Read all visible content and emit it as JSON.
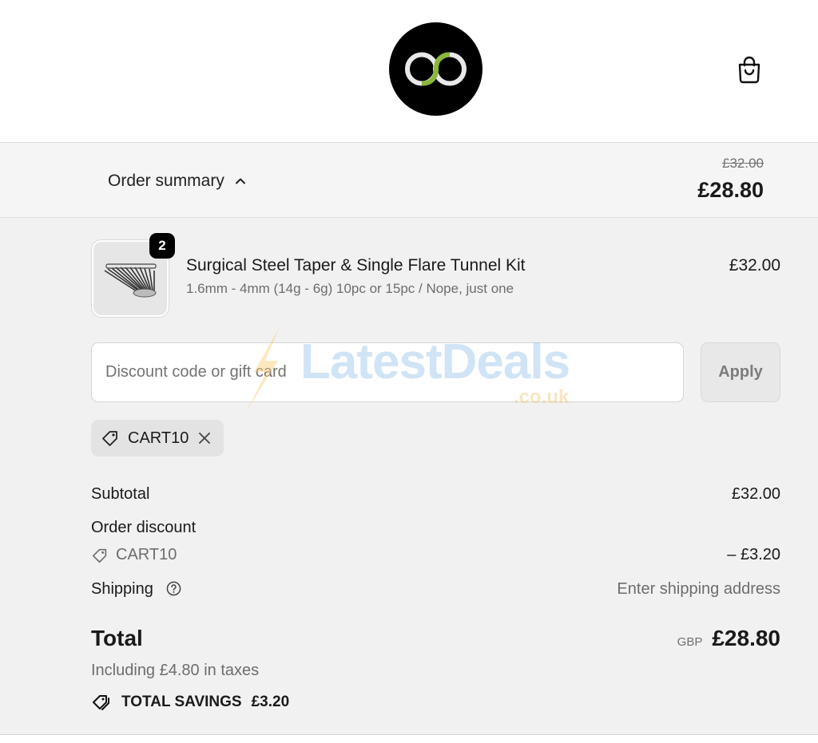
{
  "header": {
    "logo": "store-logo",
    "cart_icon": "shopping-bag-icon"
  },
  "summary_bar": {
    "label": "Order summary",
    "original_price": "£32.00",
    "discounted_price": "£28.80"
  },
  "line_items": [
    {
      "quantity": "2",
      "name": "Surgical Steel Taper & Single Flare Tunnel Kit",
      "variant": "1.6mm - 4mm (14g - 6g) 10pc or 15pc / Nope, just one",
      "price": "£32.00"
    }
  ],
  "discount": {
    "placeholder": "Discount code or gift card",
    "apply_label": "Apply",
    "applied_code": "CART10"
  },
  "watermark": {
    "text": "LatestDeals",
    "sub": ".co.uk"
  },
  "totals": {
    "subtotal_label": "Subtotal",
    "subtotal_value": "£32.00",
    "order_discount_label": "Order discount",
    "order_discount_code": "CART10",
    "order_discount_value": "– £3.20",
    "shipping_label": "Shipping",
    "shipping_value": "Enter shipping address",
    "total_label": "Total",
    "currency": "GBP",
    "total_value": "£28.80",
    "tax_note": "Including £4.80 in taxes",
    "savings_label": "TOTAL SAVINGS",
    "savings_value": "£3.20"
  },
  "colors": {
    "accent": "#8bb73a",
    "panel_bg": "#f1f1f1",
    "text": "#1a1a1a",
    "muted": "#6d6d6d"
  }
}
